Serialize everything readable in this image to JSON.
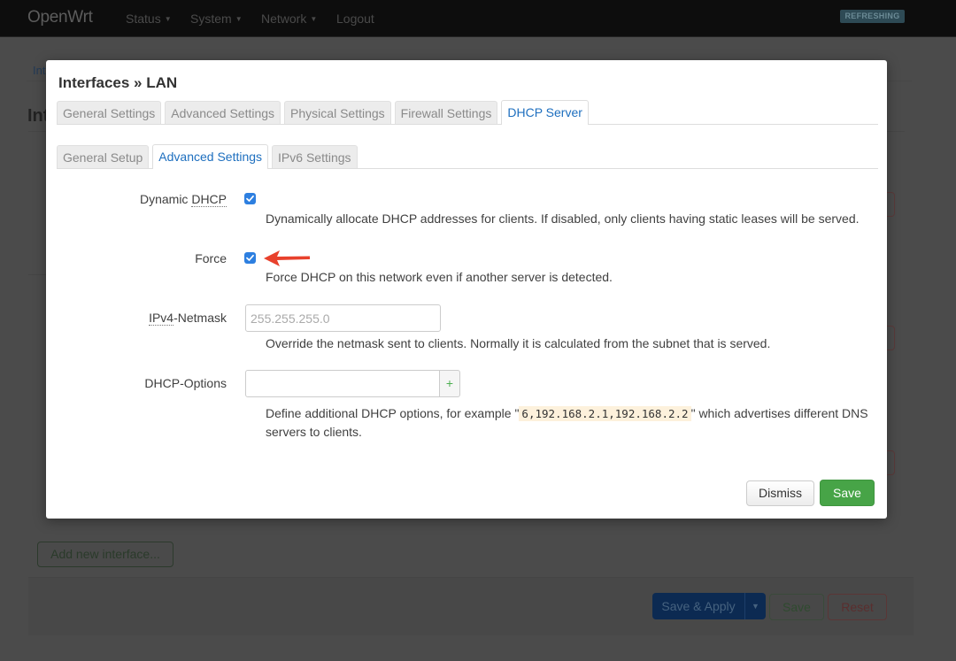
{
  "navbar": {
    "brand": "OpenWrt",
    "menu": [
      {
        "label": "Status",
        "dropdown": true
      },
      {
        "label": "System",
        "dropdown": true
      },
      {
        "label": "Network",
        "dropdown": true
      },
      {
        "label": "Logout",
        "dropdown": false
      }
    ],
    "status_badge": "REFRESHING"
  },
  "background": {
    "breadcrumb_visible": "Int",
    "page_title_visible": "Int",
    "add_interface_label": "Add new interface...",
    "footer": {
      "save_apply_label": "Save & Apply",
      "save_label": "Save",
      "reset_label": "Reset"
    }
  },
  "modal": {
    "title": "Interfaces » LAN",
    "tabs": [
      {
        "label": "General Settings",
        "active": false
      },
      {
        "label": "Advanced Settings",
        "active": false
      },
      {
        "label": "Physical Settings",
        "active": false
      },
      {
        "label": "Firewall Settings",
        "active": false
      },
      {
        "label": "DHCP Server",
        "active": true
      }
    ],
    "subtabs": [
      {
        "label": "General Setup",
        "active": false
      },
      {
        "label": "Advanced Settings",
        "active": true
      },
      {
        "label": "IPv6 Settings",
        "active": false
      }
    ],
    "fields": {
      "dynamic_dhcp": {
        "label_prefix": "Dynamic ",
        "label_abbr": "DHCP",
        "checked": true,
        "description": "Dynamically allocate DHCP addresses for clients. If disabled, only clients having static leases will be served."
      },
      "force": {
        "label": "Force",
        "checked": true,
        "description": "Force DHCP on this network even if another server is detected."
      },
      "ipv4_netmask": {
        "label_abbr": "IPv4",
        "label_suffix": "-Netmask",
        "value": "",
        "placeholder": "255.255.255.0",
        "description": "Override the netmask sent to clients. Normally it is calculated from the subnet that is served."
      },
      "dhcp_options": {
        "label": "DHCP-Options",
        "value": "",
        "add_button": "+",
        "description_before": "Define additional DHCP options, for example \"",
        "example": "6,192.168.2.1,192.168.2.2",
        "description_after": "\" which advertises different DNS",
        "description_line2": "servers to clients."
      }
    },
    "buttons": {
      "dismiss": "Dismiss",
      "save": "Save"
    }
  },
  "annotation": {
    "arrow_color": "#e8412c",
    "points_to": "force-checkbox"
  }
}
